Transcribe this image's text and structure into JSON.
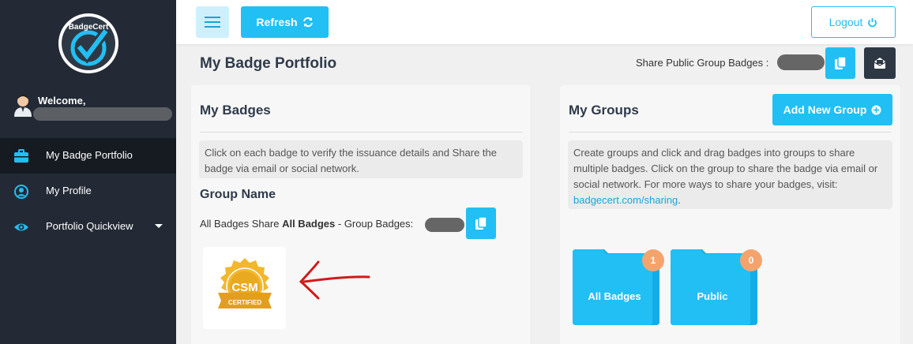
{
  "sidebar": {
    "logo_text": "BadgeCert",
    "welcome_label": "Welcome,",
    "items": [
      {
        "label": "My Badge Portfolio",
        "icon": "briefcase-icon"
      },
      {
        "label": "My Profile",
        "icon": "user-circle-icon"
      },
      {
        "label": "Portfolio Quickview",
        "icon": "eye-icon"
      }
    ]
  },
  "topbar": {
    "refresh_label": "Refresh",
    "logout_label": "Logout"
  },
  "page": {
    "title": "My Badge Portfolio",
    "share_public_label": "Share Public Group Badges :"
  },
  "my_badges": {
    "title": "My Badges",
    "info": "Click on each badge to verify the issuance details and Share the badge via email or social network.",
    "group_name_label": "Group Name",
    "share_prefix": "All Badges Share ",
    "share_bold": "All Badges",
    "share_suffix": " - Group Badges:",
    "badge": {
      "main": "CSM",
      "sub": "CERTIFIED"
    }
  },
  "my_groups": {
    "title": "My Groups",
    "add_label": "Add New Group",
    "info": "Create groups and click and drag badges into groups to share multiple badges. Click on the group to share the badge via email or social network. For more ways to share your badges, visit:",
    "link": "badgecert.com/sharing",
    "link_suffix": ".",
    "folders": [
      {
        "label": "All Badges",
        "count": "1"
      },
      {
        "label": "Public",
        "count": "0"
      }
    ]
  },
  "colors": {
    "accent": "#21bff4",
    "sidebar": "#232a35",
    "badge_gold": "#f3b72c",
    "count_badge": "#f5a36d"
  }
}
